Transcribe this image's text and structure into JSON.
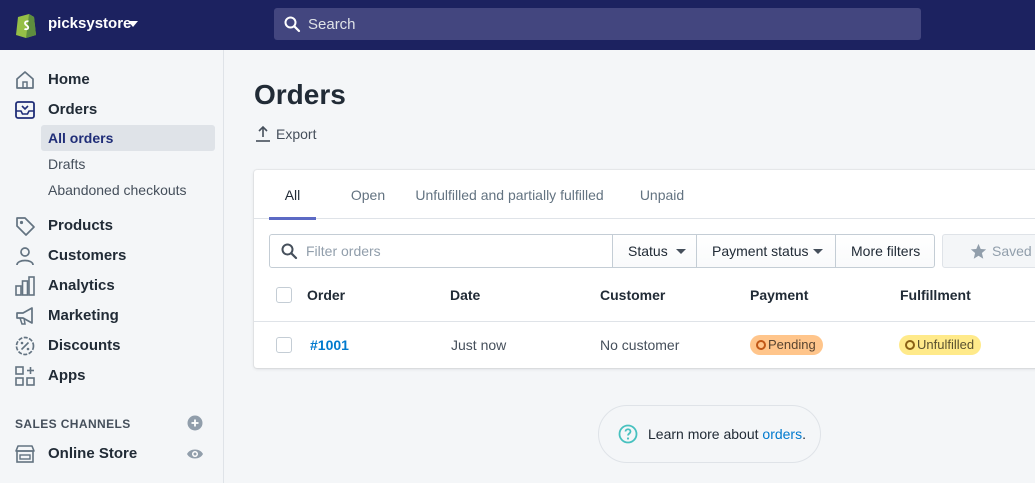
{
  "topbar": {
    "store_name": "picksystore",
    "search_placeholder": "Search"
  },
  "sidebar": {
    "items": [
      {
        "label": "Home",
        "icon": "home-icon"
      },
      {
        "label": "Orders",
        "icon": "orders-icon"
      },
      {
        "label": "Products",
        "icon": "tag-icon"
      },
      {
        "label": "Customers",
        "icon": "person-icon"
      },
      {
        "label": "Analytics",
        "icon": "bar-chart-icon"
      },
      {
        "label": "Marketing",
        "icon": "megaphone-icon"
      },
      {
        "label": "Discounts",
        "icon": "discount-icon"
      },
      {
        "label": "Apps",
        "icon": "apps-icon"
      }
    ],
    "orders_subitems": [
      {
        "label": "All orders",
        "active": true
      },
      {
        "label": "Drafts",
        "active": false
      },
      {
        "label": "Abandoned checkouts",
        "active": false
      }
    ],
    "sales_channels_title": "SALES CHANNELS",
    "channel": {
      "label": "Online Store",
      "icon": "store-icon"
    }
  },
  "page": {
    "title": "Orders",
    "export_label": "Export"
  },
  "tabs": [
    {
      "label": "All",
      "active": true
    },
    {
      "label": "Open",
      "active": false
    },
    {
      "label": "Unfulfilled and partially fulfilled",
      "active": false
    },
    {
      "label": "Unpaid",
      "active": false
    }
  ],
  "filters": {
    "placeholder": "Filter orders",
    "status": "Status",
    "payment_status": "Payment status",
    "more_filters": "More filters",
    "saved": "Saved"
  },
  "table": {
    "columns": [
      "Order",
      "Date",
      "Customer",
      "Payment",
      "Fulfillment"
    ],
    "rows": [
      {
        "order": "#1001",
        "date": "Just now",
        "customer": "No customer",
        "payment": "Pending",
        "fulfillment": "Unfulfilled"
      }
    ]
  },
  "learn_more": {
    "prefix": "Learn more about ",
    "link": "orders",
    "suffix": "."
  },
  "colors": {
    "topbar": "#1c2260",
    "accent": "#5c6ac4",
    "link": "#007ace",
    "pending_badge": "#ffc58b",
    "unfulfilled_badge": "#ffea8a"
  }
}
